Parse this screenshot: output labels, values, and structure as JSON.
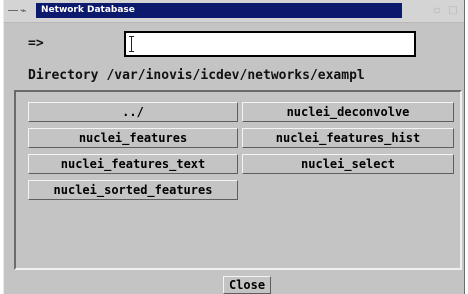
{
  "window": {
    "title": "Network Database",
    "menu_icon": "minus-icon",
    "app_icon": "network-icon",
    "controls": [
      "minimize-icon",
      "maximize-icon"
    ]
  },
  "prompt": {
    "label": "=>",
    "input_value": ""
  },
  "directory": {
    "label": "Directory",
    "path": "/var/inovis/icdev/networks/exampl"
  },
  "entries": [
    "../",
    "nuclei_deconvolve",
    "nuclei_features",
    "nuclei_features_hist",
    "nuclei_features_text",
    "nuclei_select",
    "nuclei_sorted_features"
  ],
  "close_label": "Close",
  "colors": {
    "title_bar": "#0c1a6e",
    "window_bg": "#c4c4c4"
  }
}
